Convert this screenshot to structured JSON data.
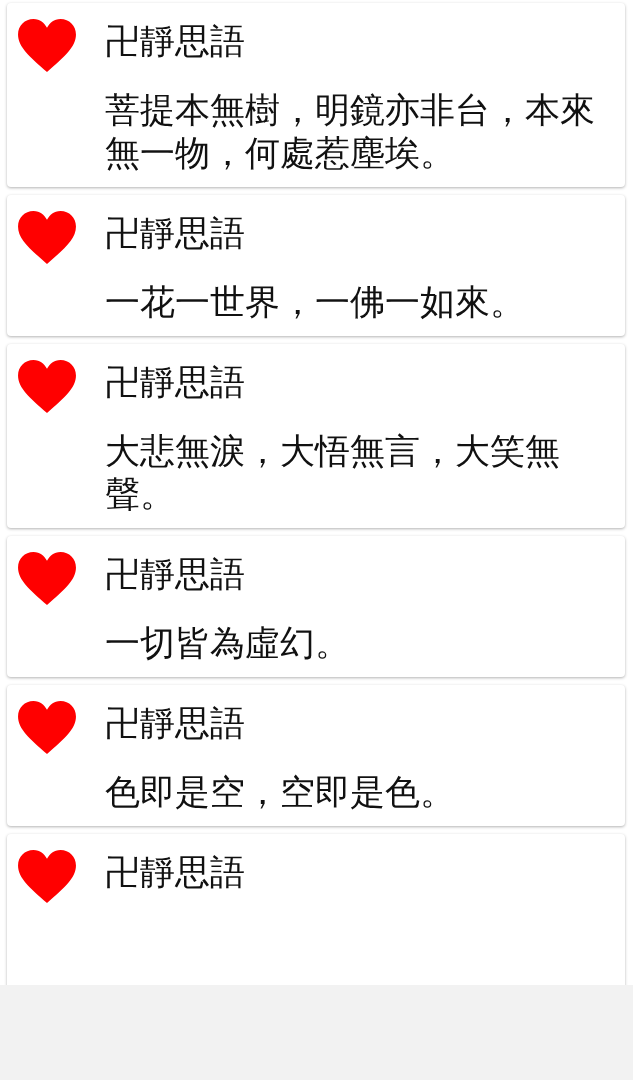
{
  "cards": [
    {
      "title": "卍靜思語",
      "text": "菩提本無樹，明鏡亦非台，本來無一物，何處惹塵埃。"
    },
    {
      "title": "卍靜思語",
      "text": "一花一世界，一佛一如來。"
    },
    {
      "title": "卍靜思語",
      "text": "大悲無淚，大悟無言，大笑無聲。"
    },
    {
      "title": "卍靜思語",
      "text": "一切皆為虛幻。"
    },
    {
      "title": "卍靜思語",
      "text": "色即是空，空即是色。"
    },
    {
      "title": "卍靜思語"
    }
  ]
}
